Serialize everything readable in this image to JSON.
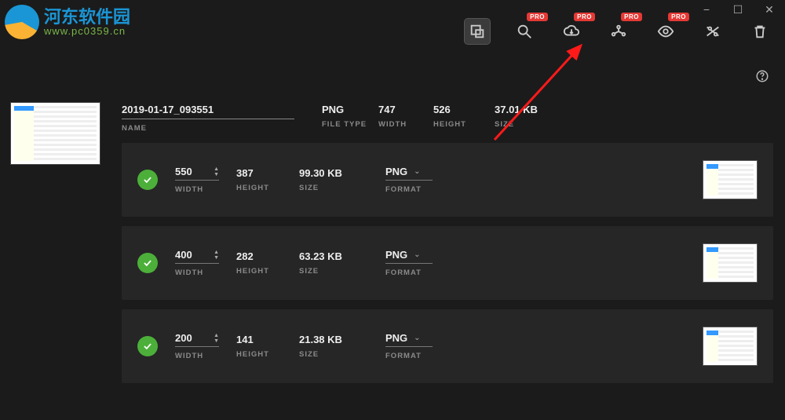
{
  "logo": {
    "cn": "河东软件园",
    "url": "www.pc0359.cn"
  },
  "window": {
    "minimize": "−",
    "maximize": "☐",
    "close": "✕"
  },
  "badges": {
    "pro": "PRO"
  },
  "header": {
    "name": {
      "value": "2019-01-17_093551",
      "label": "NAME"
    },
    "type": {
      "value": "PNG",
      "label": "FILE TYPE"
    },
    "width": {
      "value": "747",
      "label": "WIDTH"
    },
    "height": {
      "value": "526",
      "label": "HEIGHT"
    },
    "size": {
      "value": "37.01 KB",
      "label": "SIZE"
    }
  },
  "labels": {
    "width": "WIDTH",
    "height": "HEIGHT",
    "size": "SIZE",
    "format": "FORMAT"
  },
  "rows": [
    {
      "width": "550",
      "height": "387",
      "size": "99.30 KB",
      "format": "PNG"
    },
    {
      "width": "400",
      "height": "282",
      "size": "63.23 KB",
      "format": "PNG"
    },
    {
      "width": "200",
      "height": "141",
      "size": "21.38 KB",
      "format": "PNG"
    }
  ]
}
